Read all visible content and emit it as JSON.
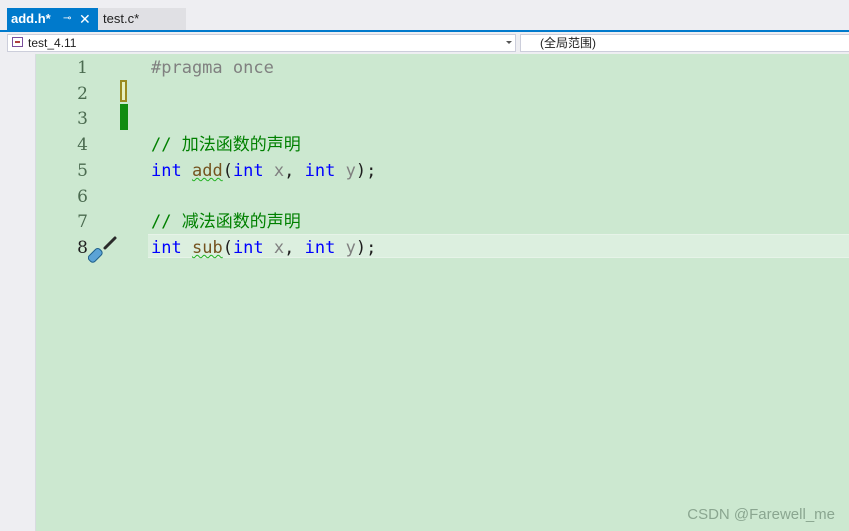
{
  "tabs": [
    {
      "label": "add.h*",
      "active": true,
      "pin_icon": "pin-icon",
      "close_icon": "close-icon"
    },
    {
      "label": "test.c*",
      "active": false
    }
  ],
  "navbar": {
    "project": "test_4.11",
    "scope": "(全局范围)"
  },
  "editor": {
    "line_numbers": [
      "1",
      "2",
      "3",
      "4",
      "5",
      "6",
      "7",
      "8"
    ],
    "current_line": 8,
    "lines": [
      {
        "pragma": "#pragma once"
      },
      {},
      {},
      {
        "comment": "// 加法函数的声明"
      },
      {
        "ret": "int",
        "name": "add",
        "open": "(",
        "t1": "int",
        "p1": "x",
        "sep": ", ",
        "t2": "int",
        "p2": "y",
        "close": ");"
      },
      {},
      {
        "comment": "// 减法函数的声明"
      },
      {
        "ret": "int",
        "name": "sub",
        "open": "(",
        "t1": "int",
        "p1": "x",
        "sep": ", ",
        "t2": "int",
        "p2": "y",
        "close": ");"
      }
    ]
  },
  "watermark": "CSDN @Farewell_me",
  "colors": {
    "accent": "#007acc",
    "editor_background": "#cce8d0",
    "keyword": "#0000ff",
    "comment": "#008000"
  }
}
